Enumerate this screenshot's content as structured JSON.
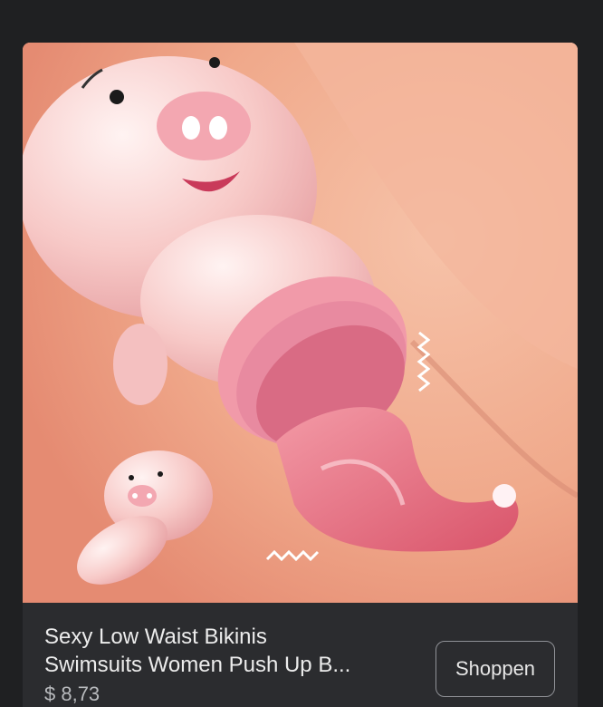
{
  "ad": {
    "image_alt": "Product image",
    "title_line1": "Sexy Low Waist Bikinis",
    "title_line2": "Swimsuits Women Push Up B...",
    "price": "$ 8,73",
    "cta_label": "Shoppen"
  },
  "colors": {
    "page_bg": "#1f2022",
    "card_bg": "#2b2c2f",
    "image_bg": "#f0a98b",
    "pig_pink": "#f7c9c7",
    "accent_pink": "#e88aa0"
  },
  "icons": [
    "pig-character-icon",
    "small-pig-icon",
    "vibration-lines-icon"
  ]
}
